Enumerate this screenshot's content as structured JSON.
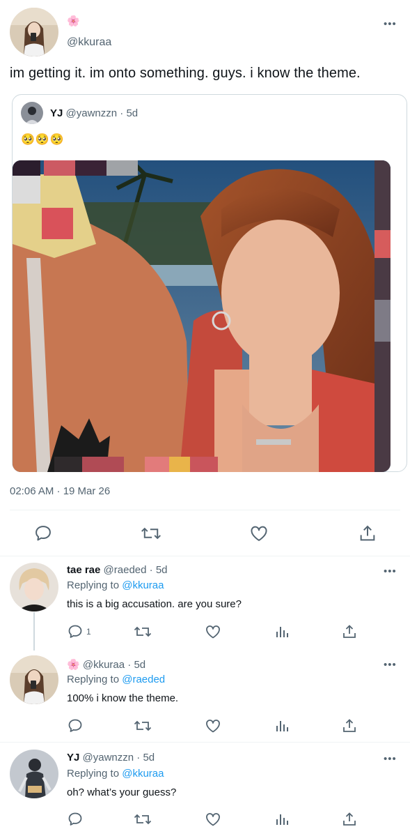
{
  "main_tweet": {
    "name_emoji": "🌸",
    "handle": "@kkuraa",
    "text": "im getting it. im onto something. guys. i know the theme.",
    "timestamp": "02:06 AM · 19 Mar 26"
  },
  "quoted_tweet": {
    "name": "YJ",
    "handle": "@yawnzzn",
    "time": "· 5d",
    "text": "🥺🥺🥺"
  },
  "more_glyph": "•••",
  "replies": [
    {
      "name": "tae rae",
      "handle": "@raeded",
      "time": "· 5d",
      "replying_prefix": "Replying to ",
      "replying_to": "@kkuraa",
      "text": "this is a big accusation. are you sure?",
      "reply_count": "1"
    },
    {
      "name_emoji": "🌸",
      "handle": "@kkuraa",
      "time": "· 5d",
      "replying_prefix": "Replying to ",
      "replying_to": "@raeded",
      "text": "100% i know the theme."
    },
    {
      "name": "YJ",
      "handle": "@yawnzzn",
      "time": "· 5d",
      "replying_prefix": "Replying to ",
      "replying_to": "@kkuraa",
      "text": "oh? what’s your guess?"
    }
  ],
  "colors": {
    "accent": "#1d9bf0",
    "secondary_text": "#536471",
    "border": "#cfd9de"
  }
}
